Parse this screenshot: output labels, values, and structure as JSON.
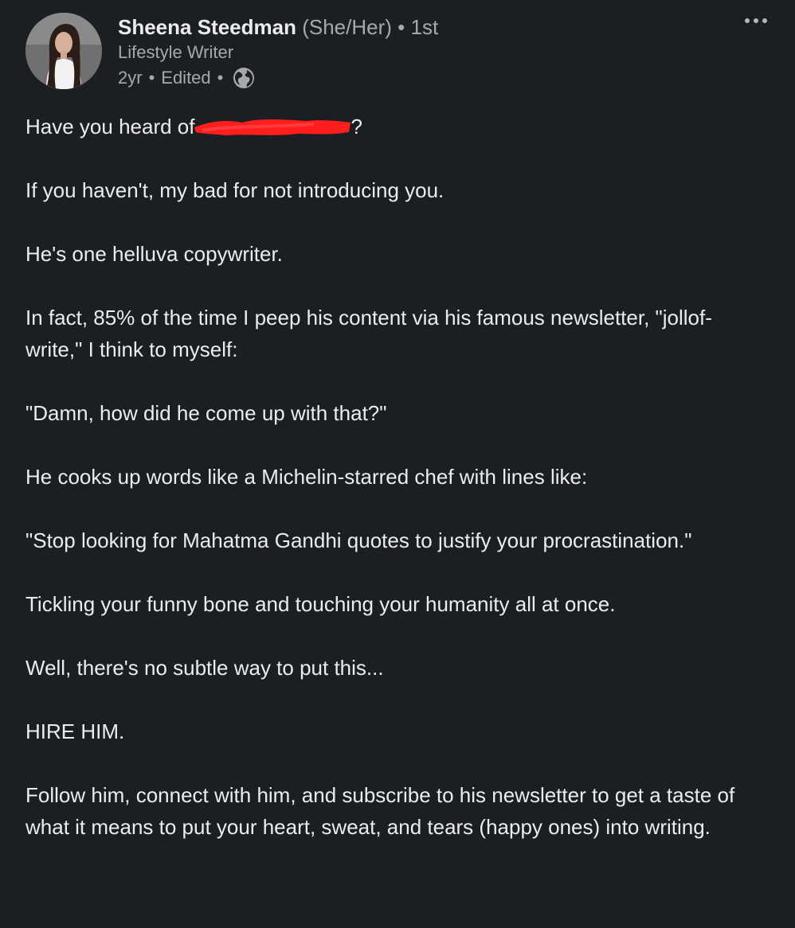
{
  "author": {
    "name": "Sheena Steedman",
    "pronouns": "(She/Her)",
    "separator": "•",
    "degree": "1st",
    "headline": "Lifestyle Writer",
    "time": "2yr",
    "edited": "Edited",
    "avatar_icon": "profile-photo",
    "visibility_icon": "globe-icon"
  },
  "menu": {
    "icon": "more-horizontal-icon",
    "label": "•••"
  },
  "post": {
    "line1_prefix": "Have you heard of",
    "line1_suffix": "?",
    "paragraphs": [
      "If you haven't, my bad for not introducing you.",
      "He's one helluva copywriter.",
      "In fact, 85% of the time I peep his content via his famous newsletter, \"jollof-write,\" I think to myself:",
      "\"Damn, how did he come up with that?\"",
      "He cooks up words like a Michelin-starred chef with lines like:",
      "\"Stop looking for Mahatma Gandhi quotes to justify your procrastination.\"",
      "Tickling your funny bone and touching your humanity all at once.",
      "Well, there's no subtle way to put this...",
      "HIRE HIM.",
      "Follow him, connect with him, and subscribe to his newsletter to get a taste of what it means to put your heart, sweat, and tears (happy ones) into writing."
    ]
  },
  "colors": {
    "background": "#1b1f23",
    "text": "#ececec",
    "muted": "#a8a8a8",
    "redaction": "#ff1e1e"
  }
}
